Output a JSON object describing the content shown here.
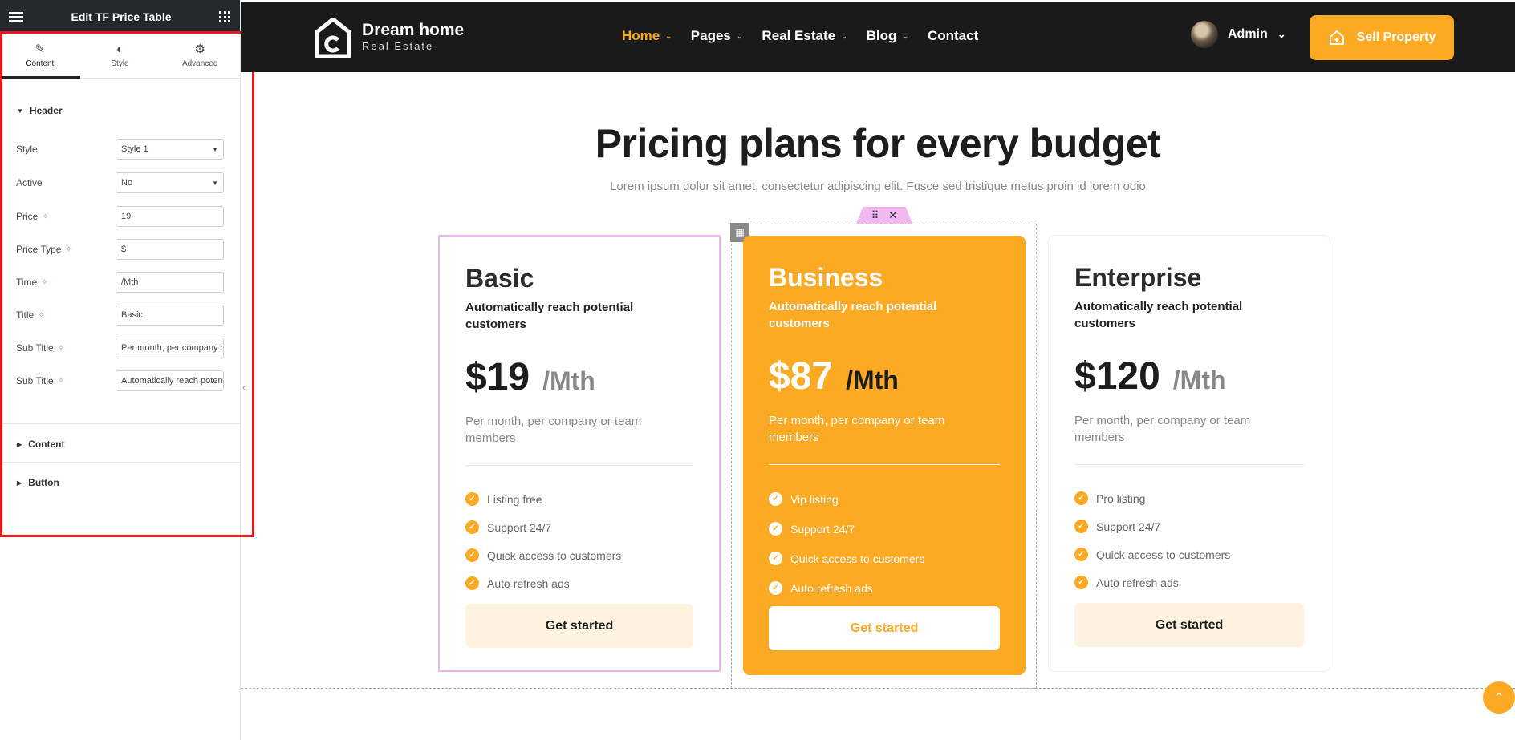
{
  "panel": {
    "title": "Edit TF Price Table",
    "tabs": [
      {
        "label": "Content"
      },
      {
        "label": "Style"
      },
      {
        "label": "Advanced"
      }
    ],
    "section_header": "Header",
    "fields": [
      {
        "label": "Style",
        "value": "Style 1"
      },
      {
        "label": "Active",
        "value": "No"
      },
      {
        "label": "Price",
        "value": "19"
      },
      {
        "label": "Price Type",
        "value": "$"
      },
      {
        "label": "Time",
        "value": "/Mth"
      },
      {
        "label": "Title",
        "value": "Basic"
      },
      {
        "label": "Sub Title",
        "value": "Per month, per company or team members"
      },
      {
        "label": "Sub Title",
        "value": "Automatically reach potential customers"
      }
    ],
    "section_content": "Content",
    "section_button": "Button"
  },
  "site": {
    "brand": {
      "name": "Dream home",
      "tagline": "Real Estate"
    },
    "nav": [
      {
        "label": "Home",
        "active": true
      },
      {
        "label": "Pages"
      },
      {
        "label": "Real Estate"
      },
      {
        "label": "Blog"
      },
      {
        "label": "Contact"
      }
    ],
    "user": "Admin",
    "cta": "Sell Property"
  },
  "pricing": {
    "heading": "Pricing plans for every budget",
    "subheading": "Lorem ipsum dolor sit amet, consectetur adipiscing elit. Fusce sed tristique metus proin id lorem odio",
    "plans": [
      {
        "name": "Basic",
        "tagline": "Automatically reach potential customers",
        "price": "$19",
        "period": "/Mth",
        "description": "Per month, per company or team members",
        "features": [
          "Listing free",
          "Support 24/7",
          "Quick access to customers",
          "Auto refresh ads"
        ],
        "button": "Get started"
      },
      {
        "name": "Business",
        "tagline": "Automatically reach potential customers",
        "price": "$87",
        "period": "/Mth",
        "description": "Per month, per company or team members",
        "features": [
          "Vip listing",
          "Support 24/7",
          "Quick access to customers",
          "Auto refresh ads"
        ],
        "button": "Get started"
      },
      {
        "name": "Enterprise",
        "tagline": "Automatically reach potential customers",
        "price": "$120",
        "period": "/Mth",
        "description": "Per month, per company or team members",
        "features": [
          "Pro listing",
          "Support 24/7",
          "Quick access to customers",
          "Auto refresh ads"
        ],
        "button": "Get started"
      }
    ]
  },
  "colors": {
    "accent": "#fca923",
    "dark": "#1a1a1a",
    "selection": "#ecb3ee",
    "frame": "#e8171d"
  }
}
